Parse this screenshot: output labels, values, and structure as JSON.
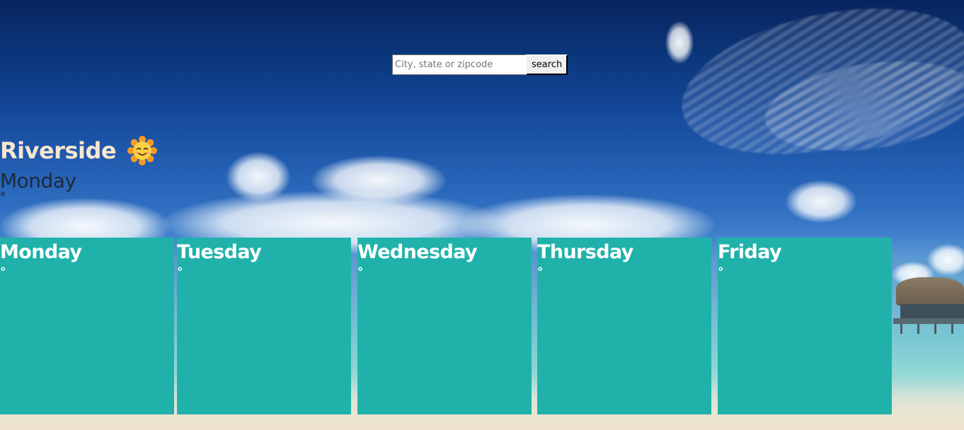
{
  "search": {
    "value": "",
    "placeholder": "City, state or zipcode",
    "button_label": "search"
  },
  "current": {
    "city": "Riverside",
    "icon": "smiling-sun-icon",
    "day": "Monday",
    "temperature": "°"
  },
  "forecast": [
    {
      "day": "Monday",
      "temperature": "°"
    },
    {
      "day": "Tuesday",
      "temperature": "°"
    },
    {
      "day": "Wednesday",
      "temperature": "°"
    },
    {
      "day": "Thursday",
      "temperature": "°"
    },
    {
      "day": "Friday",
      "temperature": "°"
    }
  ],
  "colors": {
    "card_background": "#20b2aa",
    "city_text": "#f8e6cf",
    "card_text": "#ffffff"
  }
}
